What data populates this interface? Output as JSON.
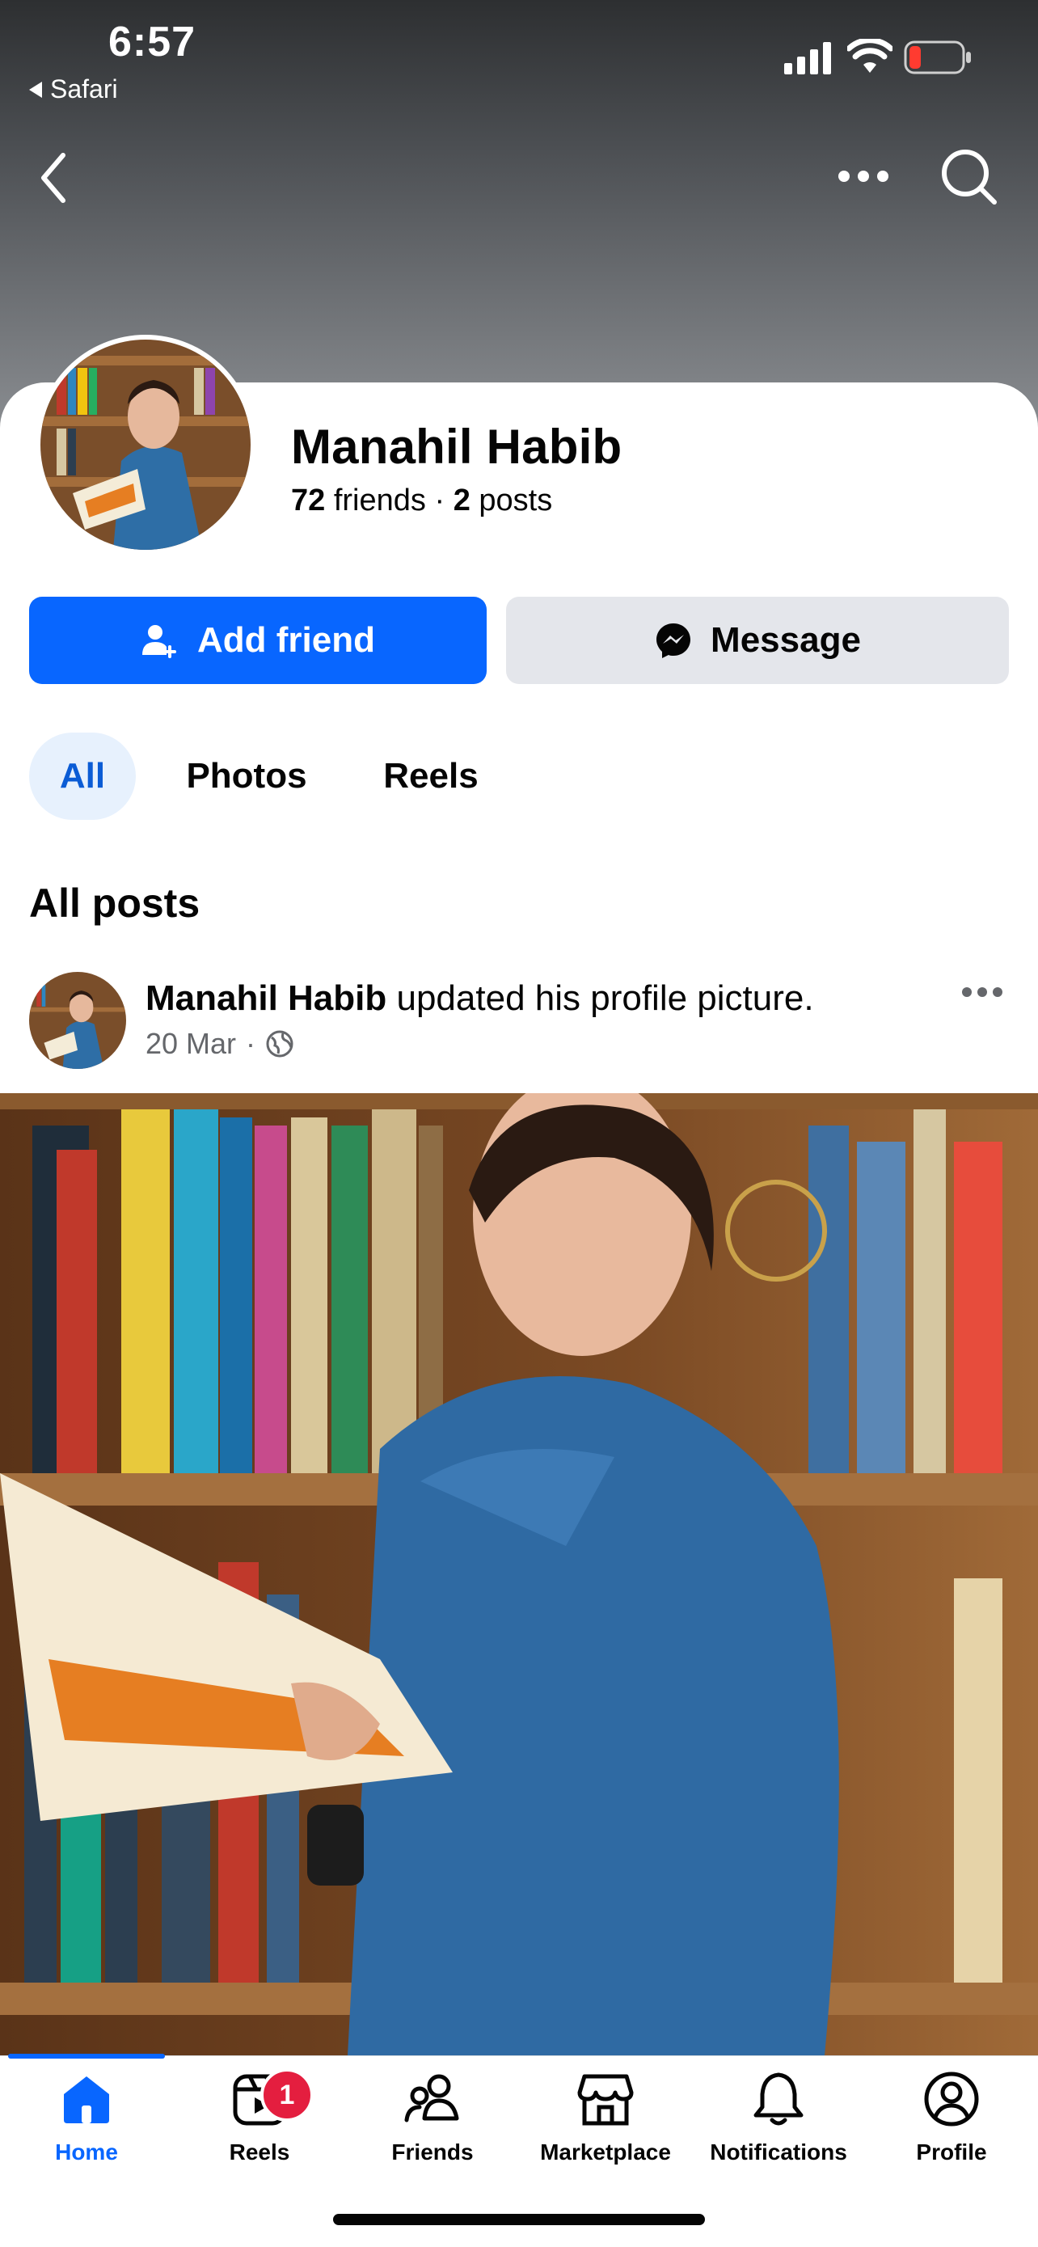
{
  "status_bar": {
    "time": "6:57",
    "back_app": "Safari"
  },
  "profile": {
    "name": "Manahil Habib",
    "friends_count": "72",
    "friends_label": "friends",
    "separator": "·",
    "posts_count": "2",
    "posts_label": "posts"
  },
  "actions": {
    "add_friend": "Add friend",
    "message": "Message"
  },
  "tabs": [
    {
      "label": "All"
    },
    {
      "label": "Photos"
    },
    {
      "label": "Reels"
    }
  ],
  "section_title": "All posts",
  "post": {
    "author": "Manahil Habib",
    "action": "updated his profile picture.",
    "date": "20 Mar",
    "dot": "·"
  },
  "bottom_nav": {
    "items": [
      {
        "label": "Home",
        "icon": "home-icon"
      },
      {
        "label": "Reels",
        "icon": "reels-icon"
      },
      {
        "label": "Friends",
        "icon": "friends-icon"
      },
      {
        "label": "Marketplace",
        "icon": "marketplace-icon"
      },
      {
        "label": "Notifications",
        "icon": "bell-icon"
      },
      {
        "label": "Profile",
        "icon": "profile-icon"
      }
    ],
    "reels_badge": "1"
  },
  "colors": {
    "accent": "#0866ff",
    "badge": "#e41e3f",
    "tab_active_bg": "#e7f1fd"
  }
}
